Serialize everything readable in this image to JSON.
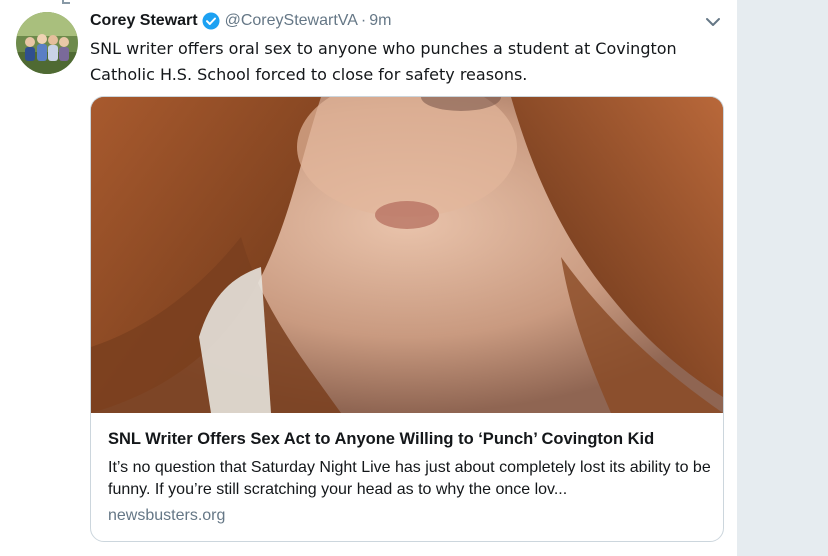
{
  "tweet": {
    "author_name": "Corey Stewart",
    "author_handle": "@CoreyStewartVA",
    "separator": "·",
    "time": "9m",
    "verified": true,
    "text": "SNL writer offers oral sex to anyone who punches a student at Covington Catholic H.S.  School forced to close for safety reasons."
  },
  "card": {
    "title": "SNL Writer Offers Sex Act to Anyone Willing to ‘Punch’ Covington Kid",
    "description": "It’s no question that Saturday Night Live has just about completely lost its ability to be funny. If you’re still scratching your head as to why the once lov...",
    "domain": "newsbusters.org"
  },
  "icons": {
    "verified": "verified-badge-icon",
    "caret": "chevron-down-icon"
  },
  "colors": {
    "primary_text": "#14171a",
    "secondary_text": "#657786",
    "verified_blue": "#1da1f2",
    "border": "#ccd6dd",
    "page_background": "#e6ecf0"
  }
}
